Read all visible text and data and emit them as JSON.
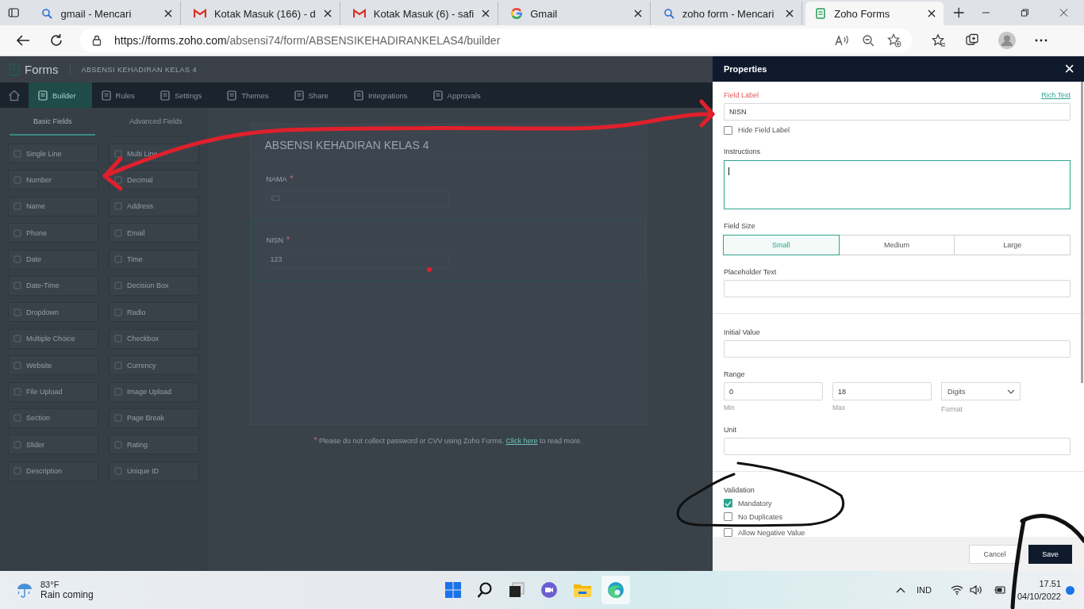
{
  "browser": {
    "tabs": [
      {
        "title": "gmail - Mencari",
        "kind": "search",
        "selected": false
      },
      {
        "title": "Kotak Masuk (166) - d",
        "kind": "mail",
        "selected": false
      },
      {
        "title": "Kotak Masuk (6) - safi",
        "kind": "mail",
        "selected": false
      },
      {
        "title": "Gmail",
        "kind": "google",
        "selected": false
      },
      {
        "title": "zoho form - Mencari",
        "kind": "search",
        "selected": false
      },
      {
        "title": "Zoho Forms",
        "kind": "forms",
        "selected": true
      }
    ],
    "url_host": "https://forms.zoho.com",
    "url_path": "/absensi74/form/ABSENSIKEHADIRANKELAS4/builder"
  },
  "app": {
    "logo": "Forms",
    "form_name": "ABSENSI KEHADIRAN KELAS 4",
    "nav": [
      {
        "label": "Builder",
        "selected": true
      },
      {
        "label": "Rules",
        "selected": false
      },
      {
        "label": "Settings",
        "selected": false
      },
      {
        "label": "Themes",
        "selected": false
      },
      {
        "label": "Share",
        "selected": false
      },
      {
        "label": "Integrations",
        "selected": false
      },
      {
        "label": "Approvals",
        "selected": false
      }
    ],
    "field_tabs": [
      {
        "label": "Basic Fields",
        "selected": true
      },
      {
        "label": "Advanced Fields",
        "selected": false
      }
    ],
    "fields": [
      "Single Line",
      "Multi Line",
      "Number",
      "Decimal",
      "Name",
      "Address",
      "Phone",
      "Email",
      "Date",
      "Time",
      "Date-Time",
      "Decision Box",
      "Dropdown",
      "Radio",
      "Multiple Choice",
      "Checkbox",
      "Website",
      "Currency",
      "File Upload",
      "Image Upload",
      "Section",
      "Page Break",
      "Slider",
      "Rating",
      "Description",
      "Unique ID"
    ],
    "canvas": {
      "title": "ABSENSI KEHADIRAN KELAS 4",
      "fields": [
        {
          "label": "NAMA",
          "required": true,
          "kind": "text",
          "selected": false
        },
        {
          "label": "NISN",
          "required": true,
          "kind": "number",
          "placeholder": "123",
          "selected": true
        }
      ]
    },
    "notice": {
      "mark": "*",
      "before": "Please do not collect password or CVV using Zoho Forms.",
      "link": "Click here",
      "after": "to read more."
    }
  },
  "properties": {
    "title": "Properties",
    "close": "×",
    "field_label": {
      "label": "Field Label",
      "rich_text": "Rich Text",
      "value": "NISN"
    },
    "hide_label": {
      "label": "Hide Field Label",
      "checked": false
    },
    "instructions": {
      "label": "Instructions"
    },
    "field_size": {
      "label": "Field Size",
      "options": [
        {
          "label": "Small",
          "selected": true
        },
        {
          "label": "Medium",
          "selected": false
        },
        {
          "label": "Large",
          "selected": false
        }
      ]
    },
    "placeholder_text": {
      "label": "Placeholder Text"
    },
    "initial_value": {
      "label": "Initial Value"
    },
    "range": {
      "label": "Range",
      "min": {
        "value": "0",
        "caption": "Min"
      },
      "max": {
        "value": "18",
        "caption": "Max"
      },
      "format": {
        "value": "Digits",
        "caption": "Format"
      }
    },
    "unit": {
      "label": "Unit"
    },
    "validation": {
      "label": "Validation",
      "options": [
        {
          "label": "Mandatory",
          "checked": true
        },
        {
          "label": "No Duplicates",
          "checked": false
        },
        {
          "label": "Allow Negative Value",
          "checked": false
        }
      ]
    },
    "cancel": "Cancel",
    "save": "Save"
  },
  "taskbar": {
    "temperature": "83°F",
    "weather": "Rain coming",
    "language": "IND",
    "time": "17.51",
    "date": "04/10/2022"
  }
}
